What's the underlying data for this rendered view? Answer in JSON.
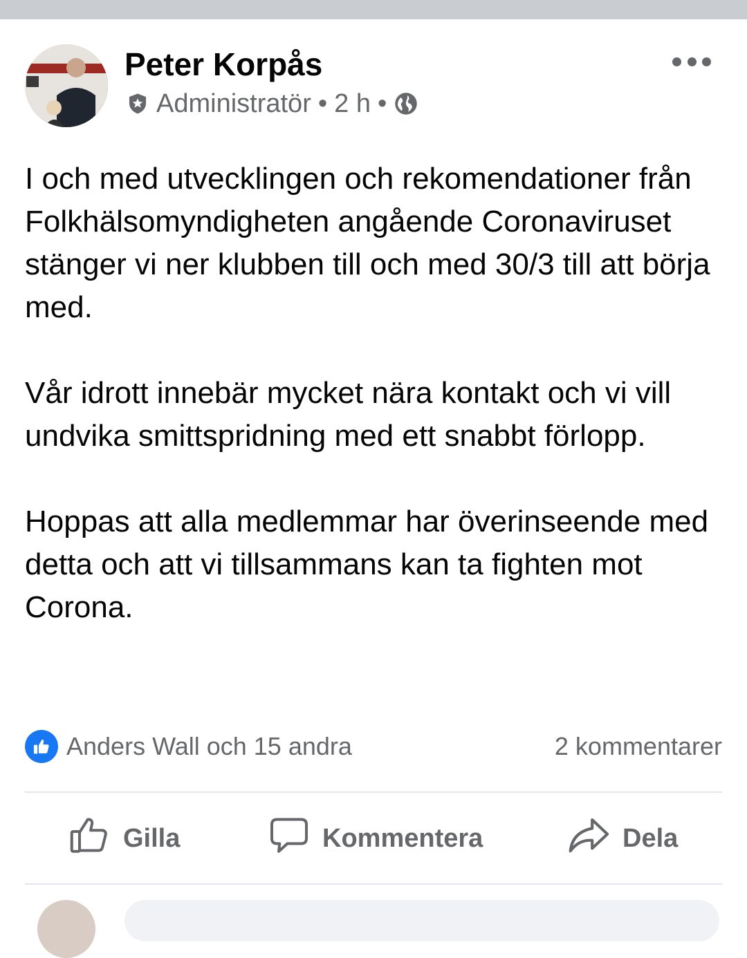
{
  "post": {
    "author": "Peter Korpås",
    "role": "Administratör",
    "separator": "•",
    "time": "2 h",
    "paragraphs": [
      "I och med utvecklingen och rekomendationer från Folkhälsomyndigheten angående Coronaviruset stänger vi ner klubben till och med 30/3 till att börja med.",
      "Vår idrott innebär mycket nära kontakt och vi vill undvika smittspridning med ett snabbt förlopp.",
      "Hoppas att alla medlemmar har överinseende med detta och att vi tillsammans kan ta fighten mot Corona."
    ]
  },
  "reactions": {
    "summary": "Anders Wall och 15 andra",
    "comments": "2 kommentarer"
  },
  "actions": {
    "like": "Gilla",
    "comment": "Kommentera",
    "share": "Dela"
  },
  "icons": {
    "admin": "shield-badge-icon",
    "audience": "globe-icon",
    "more": "more-options-icon",
    "like_badge": "thumbs-up-badge-icon",
    "like": "thumbs-up-icon",
    "comment": "speech-bubble-icon",
    "share": "share-arrow-icon"
  },
  "colors": {
    "accent": "#1877f2",
    "secondary_text": "#65676b",
    "divider": "#e4e6eb",
    "top_strip": "#c9ccd1"
  }
}
